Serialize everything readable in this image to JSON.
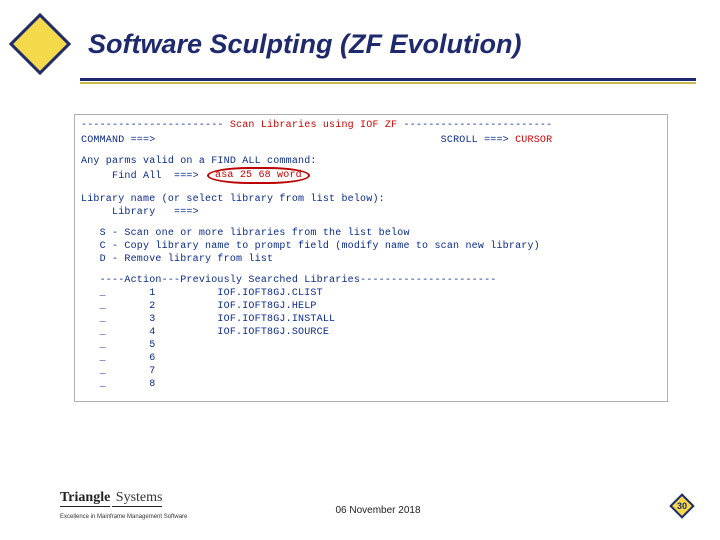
{
  "title": "Software Sculpting (ZF Evolution)",
  "terminal": {
    "dash_left": "-----------------------",
    "header_center": " Scan Libraries using IOF ZF ",
    "dash_right": "------------------------",
    "command_label": "COMMAND ===>",
    "scroll_label": "SCROLL ===>",
    "scroll_value": "CURSOR",
    "parms_line": "Any parms valid on a FIND ALL command:",
    "find_all_label": "     Find All  ===>",
    "circled_value": "asa 25 68 word",
    "lib_line": "Library name (or select library from list below):",
    "lib_label": "     Library   ===>",
    "opt_s": "   S - Scan one or more libraries from the list below",
    "opt_c": "   C - Copy library name to prompt field (modify name to scan new library)",
    "opt_d": "   D - Remove library from list",
    "list_dash_l": "   ----Action---",
    "list_header_mid": "Previously Searched Libraries",
    "list_dash_r": "----------------------",
    "rows": {
      "r1": "   _       1          IOF.IOFT8GJ.CLIST",
      "r2": "   _       2          IOF.IOFT8GJ.HELP",
      "r3": "   _       3          IOF.IOFT8GJ.INSTALL",
      "r4": "   _       4          IOF.IOFT8GJ.SOURCE",
      "r5": "   _       5",
      "r6": "   _       6",
      "r7": "   _       7",
      "r8": "   _       8"
    }
  },
  "footer": {
    "logo_left": "Triangle",
    "logo_right": " Systems",
    "tagline": "Excellence in Mainframe Management Software",
    "date": "06 November 2018",
    "page": "30"
  }
}
